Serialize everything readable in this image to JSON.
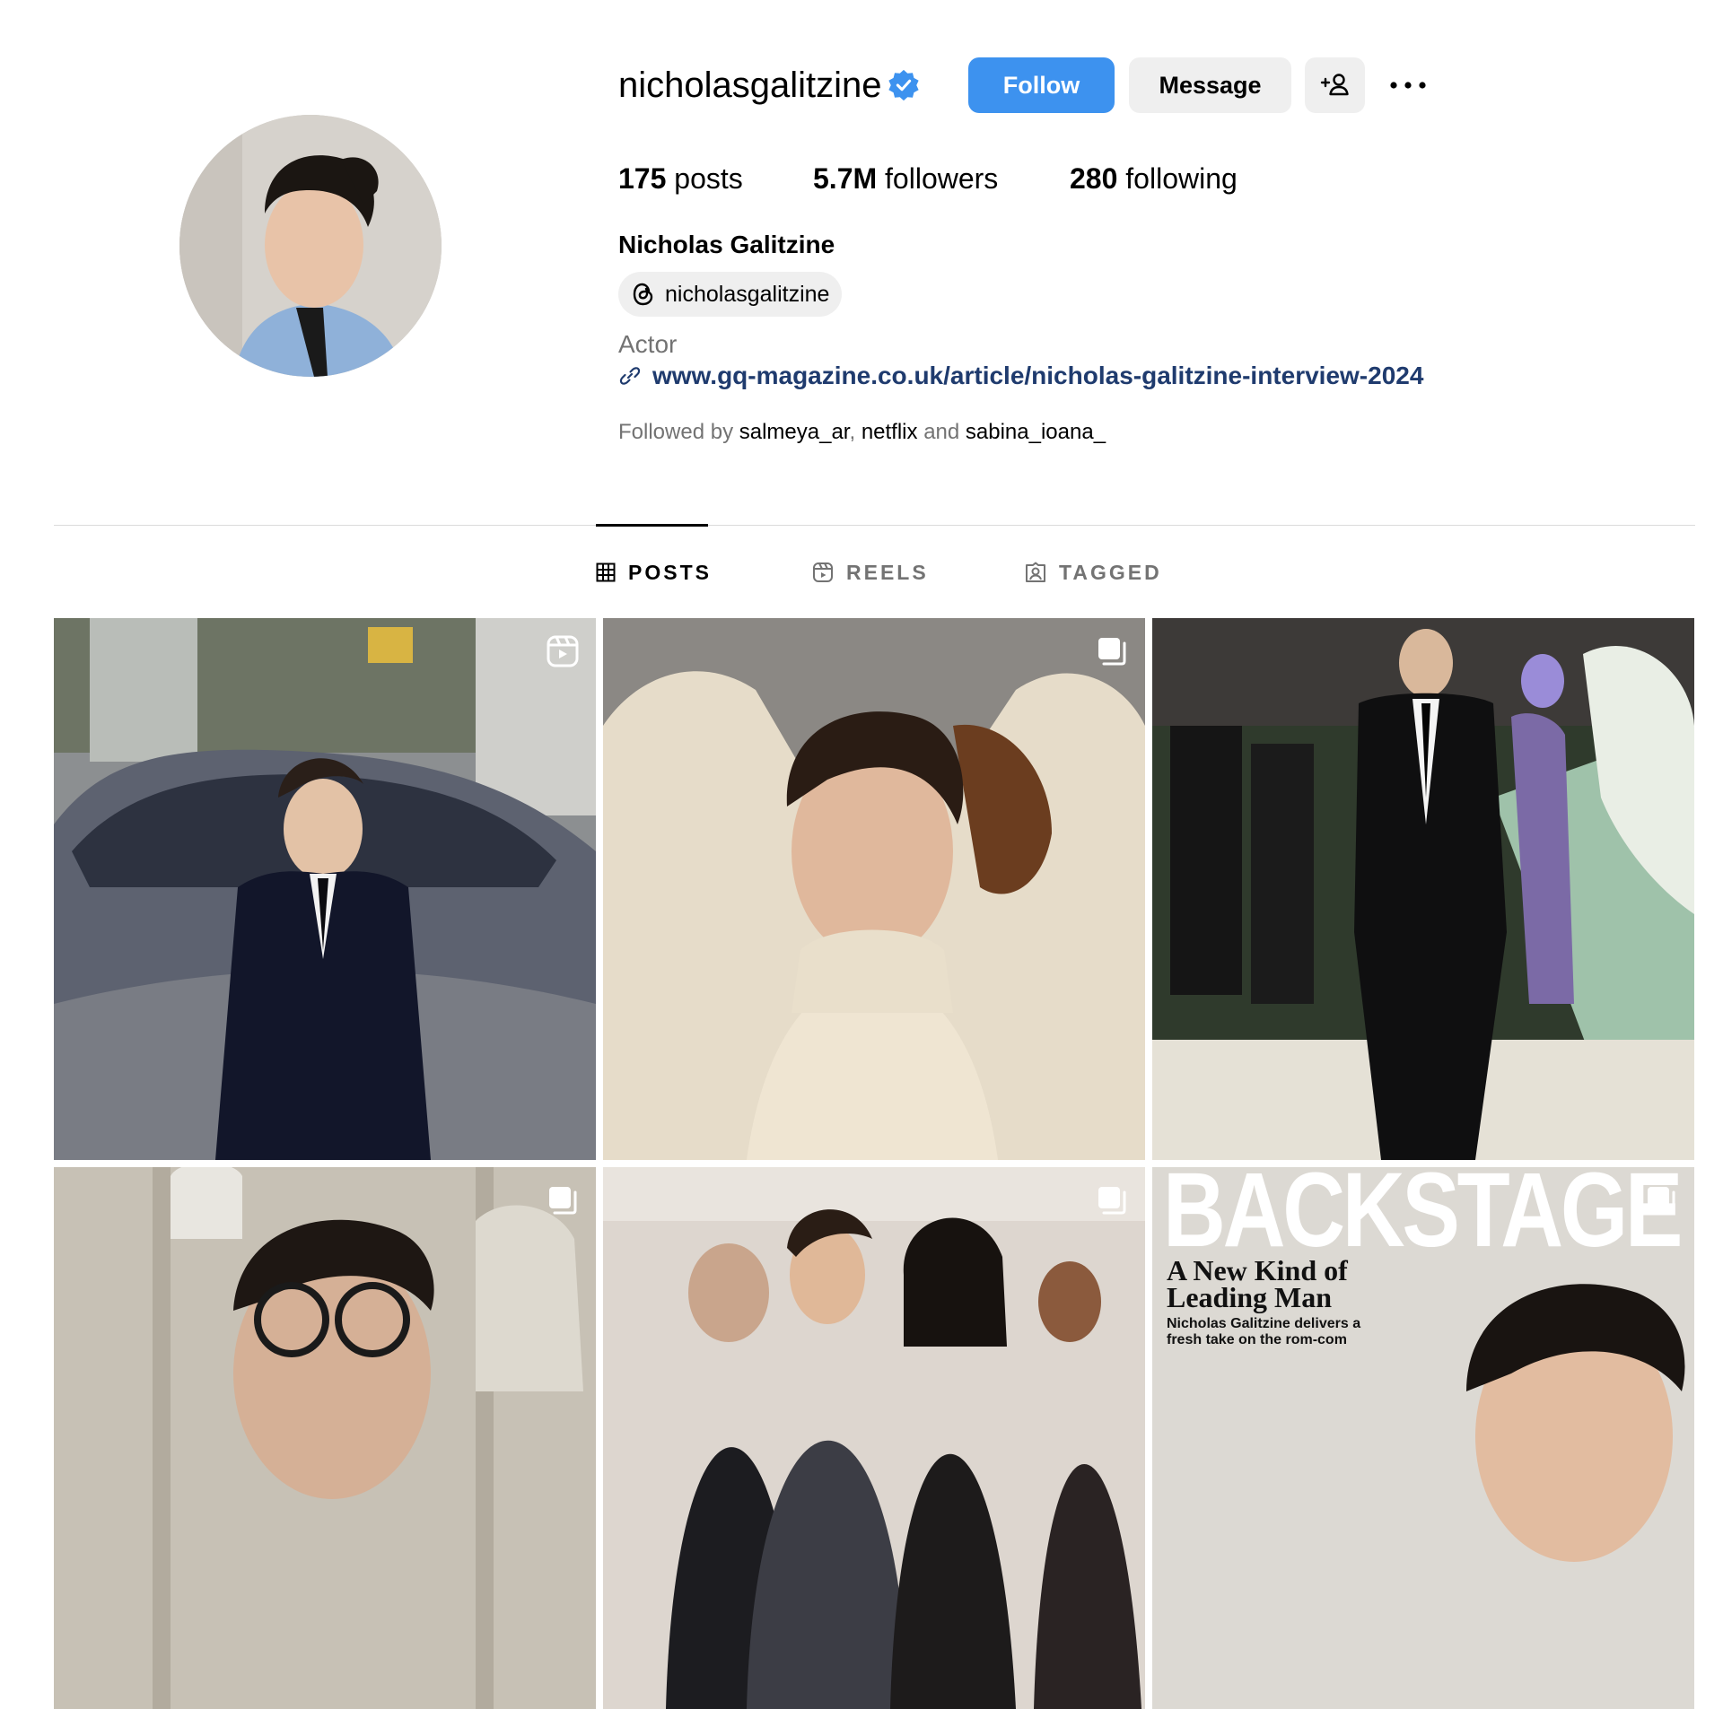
{
  "profile": {
    "username": "nicholasgalitzine",
    "full_name": "Nicholas Galitzine",
    "bio": "Actor",
    "threads_handle": "nicholasgalitzine",
    "link": "www.gq-magazine.co.uk/article/nicholas-galitzine-interview-2024",
    "verified": true,
    "avatar_alt": "avatar"
  },
  "actions": {
    "follow_label": "Follow",
    "message_label": "Message"
  },
  "stats": {
    "posts_count": "175",
    "posts_label": "posts",
    "followers_count": "5.7M",
    "followers_label": "followers",
    "following_count": "280",
    "following_label": "following"
  },
  "followed_by": {
    "prefix": "Followed by",
    "users": [
      "salmeya_ar",
      "netflix",
      "sabina_ioana_"
    ],
    "sep1": ",",
    "and": "and"
  },
  "tabs": [
    {
      "label": "POSTS",
      "icon": "grid-icon",
      "active": true
    },
    {
      "label": "REELS",
      "icon": "reels-icon",
      "active": false
    },
    {
      "label": "TAGGED",
      "icon": "tagged-icon",
      "active": false
    }
  ],
  "posts": [
    {
      "type": "reel",
      "icon": "reel-badge-icon"
    },
    {
      "type": "carousel",
      "icon": "carousel-badge-icon"
    },
    {
      "type": "image",
      "icon": ""
    },
    {
      "type": "carousel",
      "icon": "carousel-badge-icon"
    },
    {
      "type": "carousel",
      "icon": "carousel-badge-icon"
    },
    {
      "type": "carousel",
      "icon": "carousel-badge-icon",
      "magazine_title": "BACKSTAGE",
      "magazine_headline": "A New Kind of Leading Man",
      "magazine_sub": "Nicholas Galitzine delivers a fresh take on the rom-com"
    }
  ],
  "colors": {
    "accent": "#3d92ef",
    "link": "#1f3b6e",
    "muted": "#737373",
    "button_bg": "#efefef",
    "divider": "#dbdbdb"
  }
}
